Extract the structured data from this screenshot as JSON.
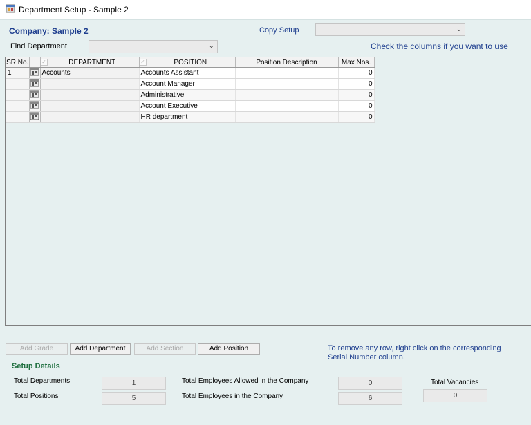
{
  "window": {
    "title": "Department Setup - Sample 2"
  },
  "header": {
    "company": "Company: Sample 2",
    "copy_setup_label": "Copy Setup",
    "copy_setup_value": "",
    "find_department_label": "Find Department",
    "find_department_value": "",
    "check_note": "Check the columns if you want to use"
  },
  "grid": {
    "columns": {
      "sr": "SR No.",
      "department": "DEPARTMENT",
      "position": "POSITION",
      "description": "Position Description",
      "max": "Max Nos."
    },
    "rows": [
      {
        "sr": "1",
        "department": "Accounts",
        "position": "Accounts Assistant",
        "description": "",
        "max": "0"
      },
      {
        "sr": "",
        "department": "",
        "position": "Account Manager",
        "description": "",
        "max": "0"
      },
      {
        "sr": "",
        "department": "",
        "position": "Administrative",
        "description": "",
        "max": "0"
      },
      {
        "sr": "",
        "department": "",
        "position": "Account Executive",
        "description": "",
        "max": "0"
      },
      {
        "sr": "",
        "department": "",
        "position": "HR department",
        "description": "",
        "max": "0"
      }
    ]
  },
  "buttons": {
    "add_grade": "Add Grade",
    "add_department": "Add Department",
    "add_section": "Add Section",
    "add_position": "Add Position"
  },
  "remove_note": "To remove any row, right click on the corresponding Serial Number column.",
  "setup": {
    "title": "Setup Details",
    "total_departments_label": "Total Departments",
    "total_departments": "1",
    "total_positions_label": "Total Positions",
    "total_positions": "5",
    "allowed_label": "Total Employees Allowed in the Company",
    "allowed": "0",
    "in_company_label": "Total Employees in the Company",
    "in_company": "6",
    "vacancies_label": "Total Vacancies",
    "vacancies": "0"
  }
}
